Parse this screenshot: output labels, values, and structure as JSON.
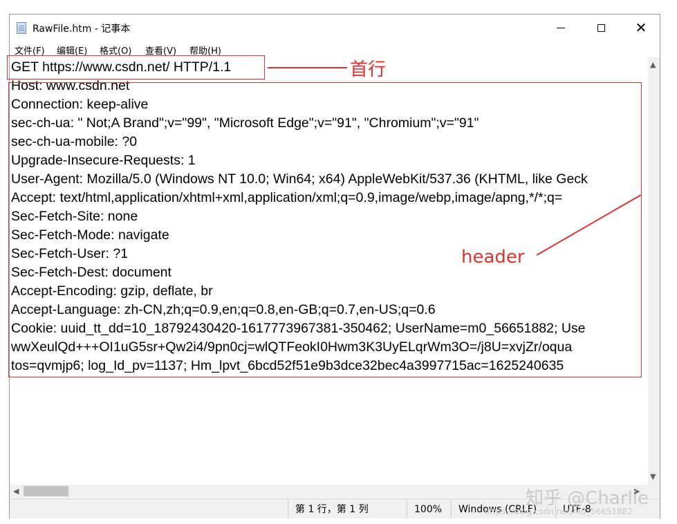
{
  "window": {
    "title": "RawFile.htm - 记事本",
    "icon": "notepad-icon"
  },
  "menu": [
    "文件(F)",
    "编辑(E)",
    "格式(O)",
    "查看(V)",
    "帮助(H)"
  ],
  "content_lines": [
    "GET https://www.csdn.net/ HTTP/1.1",
    "Host: www.csdn.net",
    "Connection: keep-alive",
    "sec-ch-ua: \" Not;A Brand\";v=\"99\", \"Microsoft Edge\";v=\"91\", \"Chromium\";v=\"91\"",
    "sec-ch-ua-mobile: ?0",
    "Upgrade-Insecure-Requests: 1",
    "User-Agent: Mozilla/5.0 (Windows NT 10.0; Win64; x64) AppleWebKit/537.36 (KHTML, like Geck",
    "Accept: text/html,application/xhtml+xml,application/xml;q=0.9,image/webp,image/apng,*/*;q=",
    "Sec-Fetch-Site: none",
    "Sec-Fetch-Mode: navigate",
    "Sec-Fetch-User: ?1",
    "Sec-Fetch-Dest: document",
    "Accept-Encoding: gzip, deflate, br",
    "Accept-Language: zh-CN,zh;q=0.9,en;q=0.8,en-GB;q=0.7,en-US;q=0.6",
    "Cookie: uuid_tt_dd=10_18792430420-1617773967381-350462; UserName=m0_56651882; Use",
    "wwXeulQd+++OI1uG5sr+Qw2i4/9pn0cj=wlQTFeokI0Hwm3K3UyELqrWm3O=/j8U=xvjZr/oqua",
    "tos=qvmjp6; log_Id_pv=1137; Hm_lpvt_6bcd52f51e9b3dce32bec4a3997715ac=1625240635"
  ],
  "annotations": {
    "first_line_label": "首行",
    "header_label": "header",
    "color": "#e0312f"
  },
  "status": {
    "position": "第 1 行，第 1 列",
    "zoom": "100%",
    "line_ending": "Windows (CRLF)",
    "encoding": "UTF-8"
  },
  "watermark": {
    "text": "知乎 @Charlie",
    "url_text": "https://blog.csdn.net/m0_56651882"
  }
}
